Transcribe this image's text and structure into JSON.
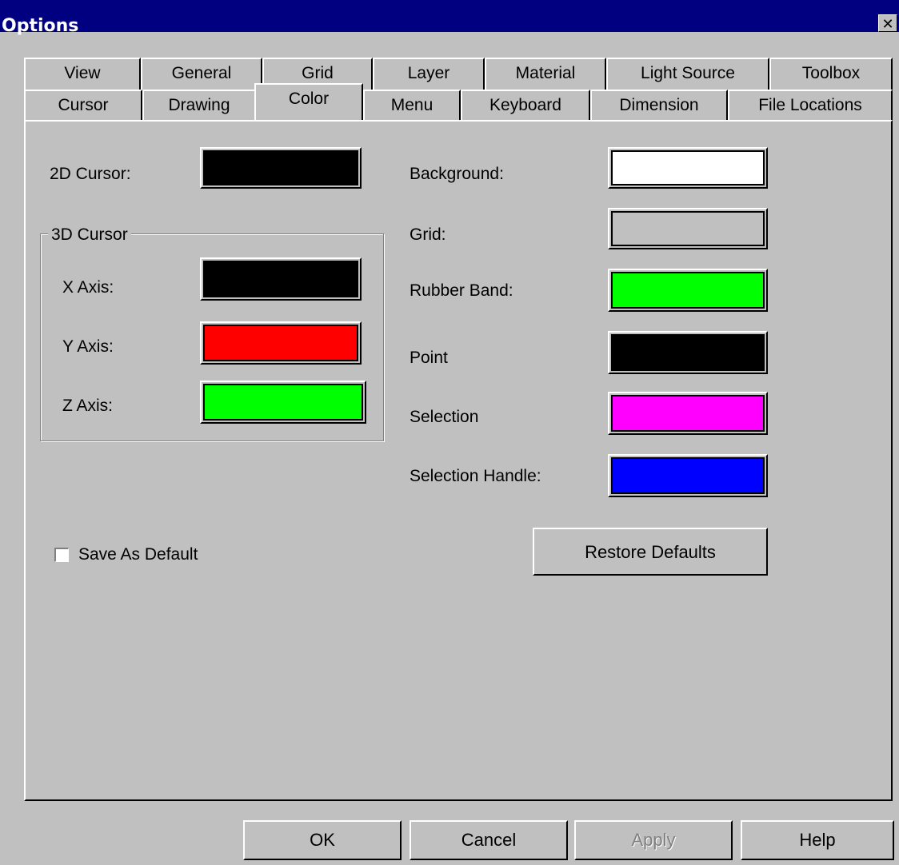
{
  "window": {
    "title": "Options",
    "close_glyph": "✕"
  },
  "tabs": {
    "row_back": [
      "View",
      "General",
      "Grid",
      "Layer",
      "Material",
      "Light Source",
      "Toolbox"
    ],
    "row_front": [
      "Cursor",
      "Drawing",
      "Color",
      "Menu",
      "Keyboard",
      "Dimension",
      "File Locations"
    ],
    "active": "Color"
  },
  "color_tab": {
    "cursor_2d_label": "2D Cursor:",
    "cursor_3d_group": "3D Cursor",
    "x_axis_label": "X Axis:",
    "y_axis_label": "Y Axis:",
    "z_axis_label": "Z Axis:",
    "background_label": "Background:",
    "grid_label": "Grid:",
    "rubber_band_label": "Rubber Band:",
    "point_label": "Point",
    "selection_label": "Selection",
    "selection_handle_label": "Selection Handle:",
    "save_as_default_label": "Save As Default",
    "save_as_default_checked": false,
    "restore_defaults_label": "Restore Defaults"
  },
  "colors": {
    "cursor_2d": "#000000",
    "x_axis": "#000000",
    "y_axis": "#ff0000",
    "z_axis": "#00ff00",
    "background": "#ffffff",
    "grid": "#c0c0c0",
    "rubber_band": "#00ff00",
    "point": "#000000",
    "selection": "#ff00ff",
    "selection_handle": "#0000ff"
  },
  "footer": {
    "ok_label": "OK",
    "cancel_label": "Cancel",
    "apply_label": "Apply",
    "help_label": "Help"
  }
}
